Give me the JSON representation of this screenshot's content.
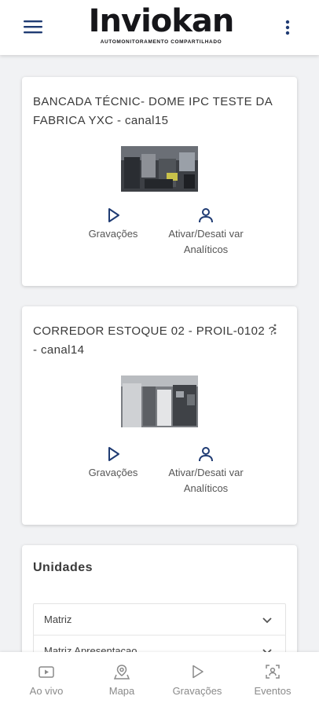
{
  "header": {
    "logo_word": "Inviokan",
    "logo_tagline": "AUTOMONITORAMENTO COMPARTILHADO"
  },
  "cameras": [
    {
      "title": "BANCADA TÉCNIC- DOME IPC TESTE DA FABRICA YXC - canal15",
      "recordings_label": "Gravações",
      "analytics_label": "Ativar/Desati var Analíticos"
    },
    {
      "title": "CORREDOR ESTOQUE 02 - PROIL-0102 ? - canal14",
      "recordings_label": "Gravações",
      "analytics_label": "Ativar/Desati var Analíticos"
    }
  ],
  "units": {
    "title": "Unidades",
    "options": [
      "Matriz",
      "Matriz Apresentacao"
    ]
  },
  "bottom_nav": [
    {
      "label": "Ao vivo",
      "icon": "live-video-icon"
    },
    {
      "label": "Mapa",
      "icon": "map-pin-icon"
    },
    {
      "label": "Gravações",
      "icon": "play-icon"
    },
    {
      "label": "Eventos",
      "icon": "events-scan-icon"
    }
  ],
  "colors": {
    "accent": "#1f3b73",
    "background": "#f1f2f4",
    "nav_inactive": "#8a8a8a"
  }
}
